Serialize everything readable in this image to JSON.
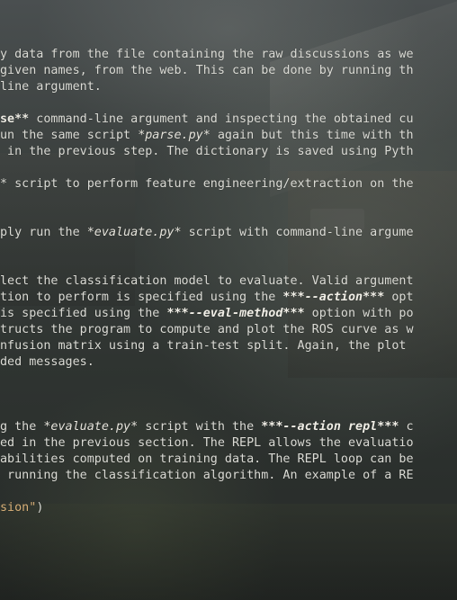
{
  "theme": {
    "text_color": "#dcdcd6",
    "string_color": "#d8b079"
  },
  "lines": [
    [
      {
        "t": "y data from the file containing the raw discussions as we"
      }
    ],
    [
      {
        "t": "given names, from the web. This can be done by running th"
      }
    ],
    [
      {
        "t": "line argument."
      }
    ],
    [],
    [
      {
        "t": "se**",
        "c": "b"
      },
      {
        "t": " command-line argument and inspecting the obtained cu"
      }
    ],
    [
      {
        "t": "un the same script "
      },
      {
        "t": "*parse.py*",
        "c": "i"
      },
      {
        "t": " again but this time with th"
      }
    ],
    [
      {
        "t": " in the previous step. The dictionary is saved using Pyth"
      }
    ],
    [],
    [
      {
        "t": "* script to perform feature engineering/extraction on the"
      }
    ],
    [],
    [],
    [
      {
        "t": "ply run the "
      },
      {
        "t": "*evaluate.py*",
        "c": "i"
      },
      {
        "t": " script with command-line argume"
      }
    ],
    [],
    [],
    [
      {
        "t": "lect the classification model to evaluate. Valid argument"
      }
    ],
    [
      {
        "t": "tion to perform is specified using the "
      },
      {
        "t": "***--action***",
        "c": "bi"
      },
      {
        "t": " opt"
      }
    ],
    [
      {
        "t": "is specified using the "
      },
      {
        "t": "***--eval-method***",
        "c": "bi"
      },
      {
        "t": " option with po"
      }
    ],
    [
      {
        "t": "tructs the program to compute and plot the ROS curve as w"
      }
    ],
    [
      {
        "t": "nfusion matrix using a train-test split. Again, the plot"
      }
    ],
    [
      {
        "t": "ded messages."
      }
    ],
    [],
    [],
    [],
    [
      {
        "t": "g the "
      },
      {
        "t": "*evaluate.py*",
        "c": "i"
      },
      {
        "t": " script with the "
      },
      {
        "t": "***--action repl***",
        "c": "bi"
      },
      {
        "t": " c"
      }
    ],
    [
      {
        "t": "ed in the previous section. The REPL allows the evaluatio"
      }
    ],
    [
      {
        "t": "abilities computed on training data. The REPL loop can be"
      }
    ],
    [
      {
        "t": " running the classification algorithm. An example of a RE"
      }
    ],
    [],
    [
      {
        "t": "sion\"",
        "c": "s"
      },
      {
        "t": ")"
      }
    ]
  ]
}
